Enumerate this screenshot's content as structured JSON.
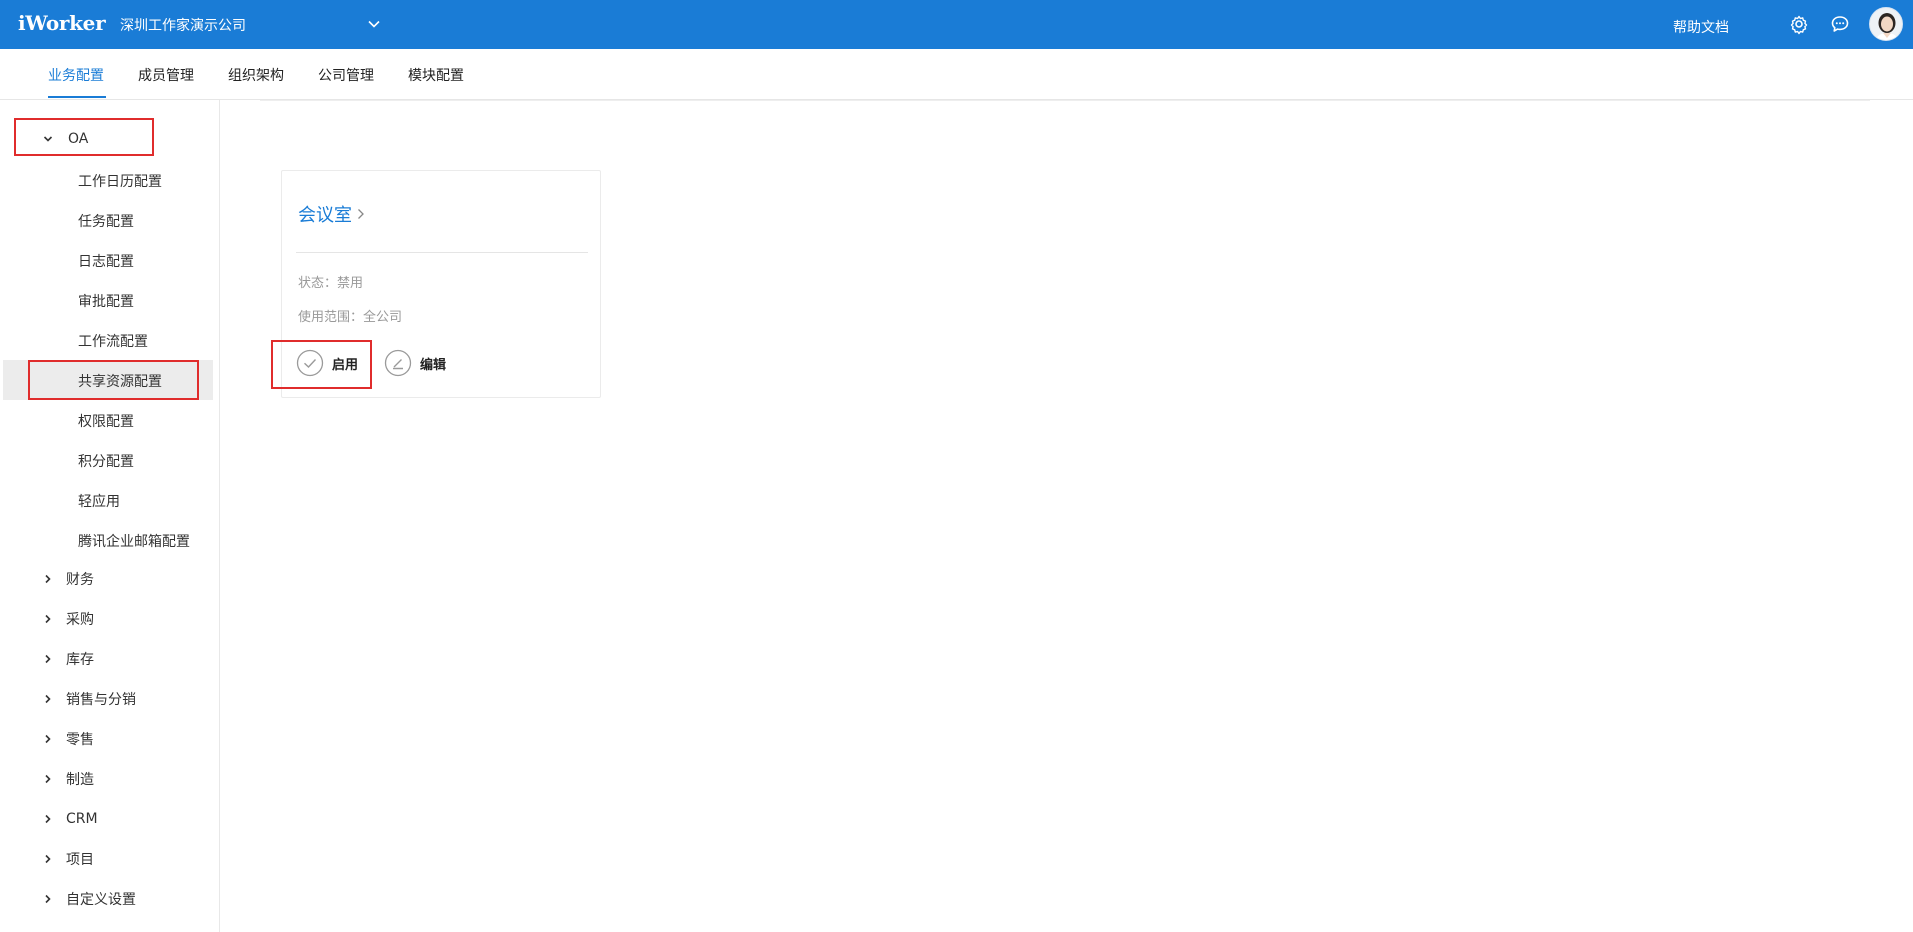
{
  "header": {
    "logo": "iWorker",
    "company": "深圳工作家演示公司",
    "help": "帮助文档",
    "icons": [
      "chevron-down-icon",
      "gear-icon",
      "chat-icon",
      "avatar"
    ]
  },
  "tabs": [
    {
      "label": "业务配置",
      "active": true
    },
    {
      "label": "成员管理",
      "active": false
    },
    {
      "label": "组织架构",
      "active": false
    },
    {
      "label": "公司管理",
      "active": false
    },
    {
      "label": "模块配置",
      "active": false
    }
  ],
  "sidebar": {
    "oa": {
      "label": "OA",
      "expanded": true,
      "items": [
        "工作日历配置",
        "任务配置",
        "日志配置",
        "审批配置",
        "工作流配置",
        "共享资源配置",
        "权限配置",
        "积分配置",
        "轻应用",
        "腾讯企业邮箱配置"
      ],
      "selected": "共享资源配置"
    },
    "groups": [
      "财务",
      "采购",
      "库存",
      "销售与分销",
      "零售",
      "制造",
      "CRM",
      "项目",
      "自定义设置"
    ]
  },
  "card": {
    "title": "会议室",
    "status": "状态：禁用",
    "scope": "使用范围：全公司",
    "enable_label": "启用",
    "edit_label": "编辑"
  },
  "colors": {
    "brand": "#1a7cd6",
    "highlight": "#e02c2c"
  }
}
